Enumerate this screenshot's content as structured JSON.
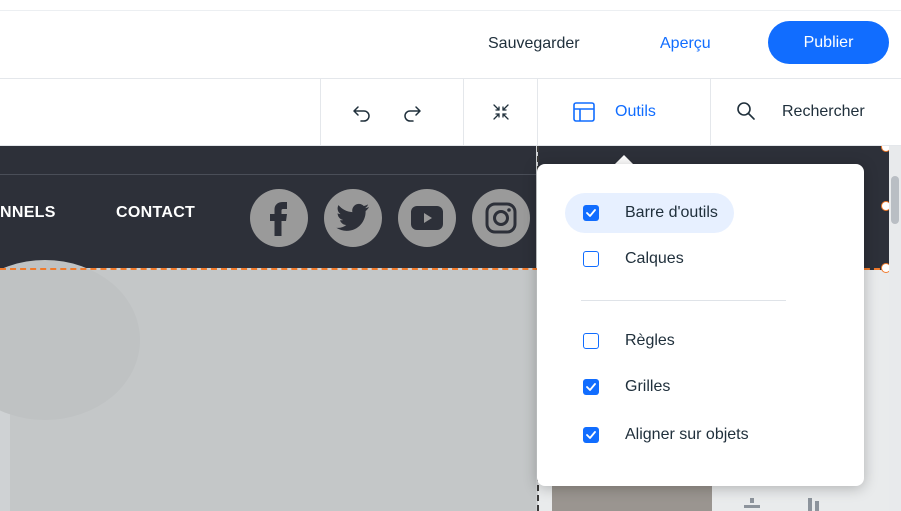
{
  "header": {
    "save_label": "Sauvegarder",
    "preview_label": "Aperçu",
    "publish_label": "Publier"
  },
  "toolbar": {
    "undo_icon": "undo-icon",
    "redo_icon": "redo-icon",
    "zoom_out_icon": "collapse-icon",
    "tools_label": "Outils",
    "search_label": "Rechercher"
  },
  "site": {
    "nav_items": [
      "NNELS",
      "CONTACT"
    ],
    "social_icons": [
      "facebook-icon",
      "twitter-icon",
      "youtube-icon",
      "instagram-icon"
    ]
  },
  "tools_menu": {
    "items": [
      {
        "label": "Barre d'outils",
        "checked": true
      },
      {
        "label": "Calques",
        "checked": false
      },
      {
        "label": "Règles",
        "checked": false
      },
      {
        "label": "Grilles",
        "checked": true
      },
      {
        "label": "Aligner sur objets",
        "checked": true
      }
    ]
  },
  "colors": {
    "accent": "#116dff",
    "selection": "#f07a2c",
    "site_header": "#2d3039"
  }
}
